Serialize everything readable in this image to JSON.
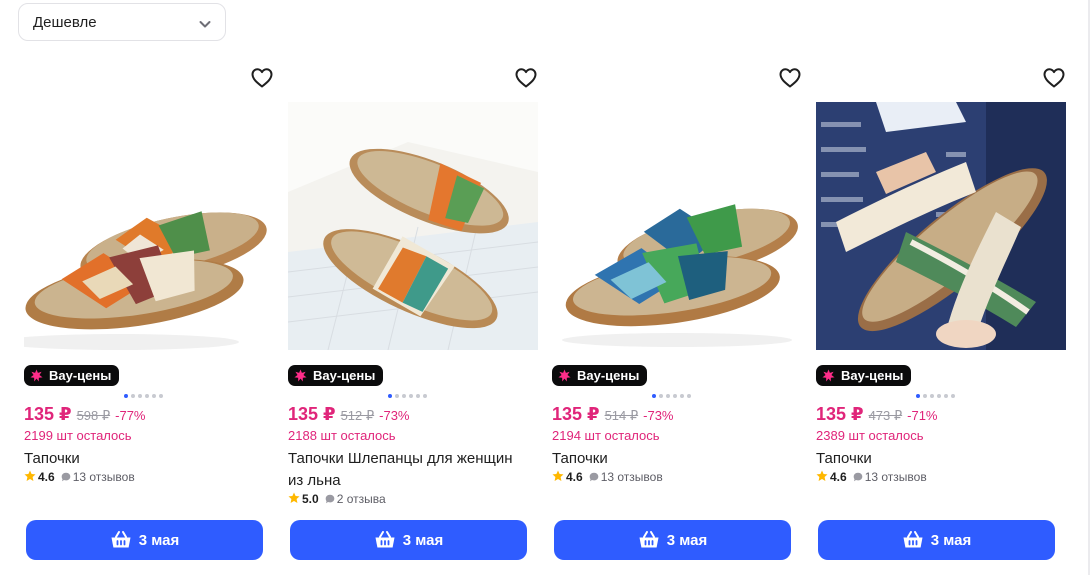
{
  "sort": {
    "label": "Дешевле"
  },
  "products": [
    {
      "badge": "Вау-цены",
      "price": "135 ₽",
      "old_price": "598 ₽",
      "discount": "-77%",
      "stock": "2199 шт осталось",
      "title": "Тапочки",
      "rating": "4.6",
      "reviews": "13 отзывов",
      "button": "3 мая",
      "image_icon": "sandal-photo",
      "active_dot": 0
    },
    {
      "badge": "Вау-цены",
      "price": "135 ₽",
      "old_price": "512 ₽",
      "discount": "-73%",
      "stock": "2188 шт осталось",
      "title": "Тапочки Шлепанцы для женщин из льна",
      "rating": "5.0",
      "reviews": "2 отзыва",
      "button": "3 мая",
      "image_icon": "sandal-photo",
      "active_dot": 0
    },
    {
      "badge": "Вау-цены",
      "price": "135 ₽",
      "old_price": "514 ₽",
      "discount": "-73%",
      "stock": "2194 шт осталось",
      "title": "Тапочки",
      "rating": "4.6",
      "reviews": "13 отзывов",
      "button": "3 мая",
      "image_icon": "sandal-photo",
      "active_dot": 0
    },
    {
      "badge": "Вау-цены",
      "price": "135 ₽",
      "old_price": "473 ₽",
      "discount": "-71%",
      "stock": "2389 шт осталось",
      "title": "Тапочки",
      "rating": "4.6",
      "reviews": "13 отзывов",
      "button": "3 мая",
      "image_icon": "sandal-photo",
      "active_dot": 0
    }
  ],
  "colors": {
    "accent": "#2f5cff",
    "price": "#e0257a",
    "badge_bg": "#0b0b0c",
    "badge_star": "#ff2d8a",
    "rating_star": "#ffb800"
  }
}
